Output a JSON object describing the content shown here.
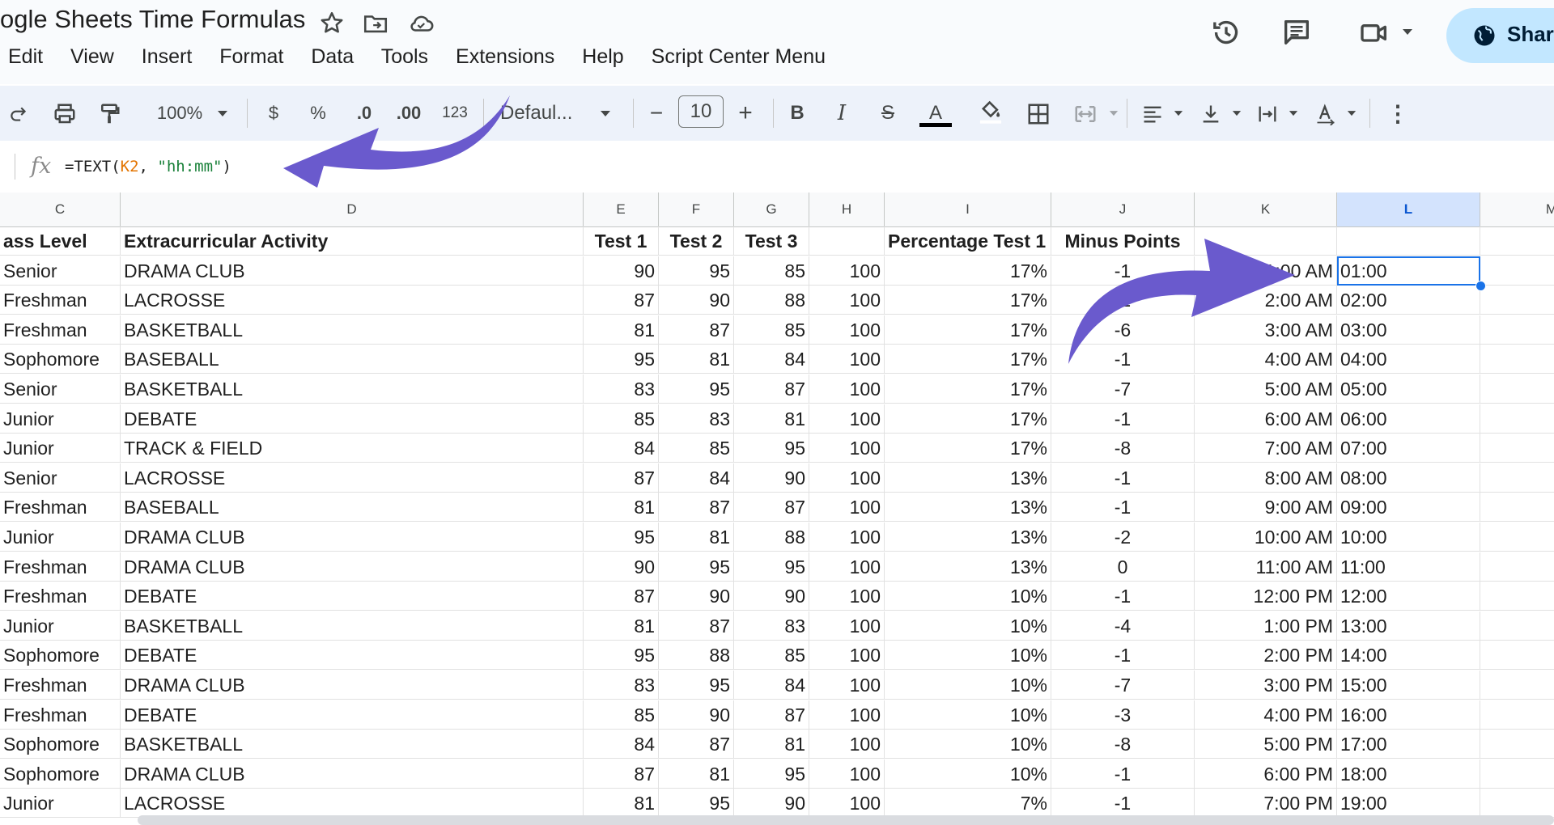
{
  "header": {
    "title": "ogle Sheets Time Formulas",
    "menu": [
      "Edit",
      "View",
      "Insert",
      "Format",
      "Data",
      "Tools",
      "Extensions",
      "Help",
      "Script Center Menu"
    ],
    "share_label": "Share"
  },
  "toolbar": {
    "zoom": "100%",
    "currency": "$",
    "percent": "%",
    "decrease_decimal": ".0",
    "increase_decimal": ".00",
    "number_format": "123",
    "font": "Defaul...",
    "font_size": "10",
    "minus": "−",
    "plus": "+",
    "bold": "B",
    "italic": "I",
    "strike": "S",
    "text_color": "A",
    "more": "⋮"
  },
  "formula_bar": {
    "fx": "fx",
    "formula_start": "=TEXT(",
    "formula_ref": "K2",
    "formula_sep": ", ",
    "formula_str": "\"hh:mm\"",
    "formula_end": ")"
  },
  "columns": [
    "C",
    "D",
    "E",
    "F",
    "G",
    "H",
    "I",
    "J",
    "K",
    "L",
    "M"
  ],
  "header_row": [
    "ass Level",
    "Extracurricular Activity",
    "Test 1",
    "Test 2",
    "Test 3",
    "",
    "Percentage Test 1",
    "Minus Points",
    "",
    "",
    ""
  ],
  "rows": [
    [
      "Senior",
      "DRAMA CLUB",
      "90",
      "95",
      "85",
      "100",
      "17%",
      "-1",
      "1:00 AM",
      "01:00"
    ],
    [
      "Freshman",
      "LACROSSE",
      "87",
      "90",
      "88",
      "100",
      "17%",
      "-1",
      "2:00 AM",
      "02:00"
    ],
    [
      "Freshman",
      "BASKETBALL",
      "81",
      "87",
      "85",
      "100",
      "17%",
      "-6",
      "3:00 AM",
      "03:00"
    ],
    [
      "Sophomore",
      "BASEBALL",
      "95",
      "81",
      "84",
      "100",
      "17%",
      "-1",
      "4:00 AM",
      "04:00"
    ],
    [
      "Senior",
      "BASKETBALL",
      "83",
      "95",
      "87",
      "100",
      "17%",
      "-7",
      "5:00 AM",
      "05:00"
    ],
    [
      "Junior",
      "DEBATE",
      "85",
      "83",
      "81",
      "100",
      "17%",
      "-1",
      "6:00 AM",
      "06:00"
    ],
    [
      "Junior",
      "TRACK & FIELD",
      "84",
      "85",
      "95",
      "100",
      "17%",
      "-8",
      "7:00 AM",
      "07:00"
    ],
    [
      "Senior",
      "LACROSSE",
      "87",
      "84",
      "90",
      "100",
      "13%",
      "-1",
      "8:00 AM",
      "08:00"
    ],
    [
      "Freshman",
      "BASEBALL",
      "81",
      "87",
      "87",
      "100",
      "13%",
      "-1",
      "9:00 AM",
      "09:00"
    ],
    [
      "Junior",
      "DRAMA CLUB",
      "95",
      "81",
      "88",
      "100",
      "13%",
      "-2",
      "10:00 AM",
      "10:00"
    ],
    [
      "Freshman",
      "DRAMA CLUB",
      "90",
      "95",
      "95",
      "100",
      "13%",
      "0",
      "11:00 AM",
      "11:00"
    ],
    [
      "Freshman",
      "DEBATE",
      "87",
      "90",
      "90",
      "100",
      "10%",
      "-1",
      "12:00 PM",
      "12:00"
    ],
    [
      "Junior",
      "BASKETBALL",
      "81",
      "87",
      "83",
      "100",
      "10%",
      "-4",
      "1:00 PM",
      "13:00"
    ],
    [
      "Sophomore",
      "DEBATE",
      "95",
      "88",
      "85",
      "100",
      "10%",
      "-1",
      "2:00 PM",
      "14:00"
    ],
    [
      "Freshman",
      "DRAMA CLUB",
      "83",
      "95",
      "84",
      "100",
      "10%",
      "-7",
      "3:00 PM",
      "15:00"
    ],
    [
      "Freshman",
      "DEBATE",
      "85",
      "90",
      "87",
      "100",
      "10%",
      "-3",
      "4:00 PM",
      "16:00"
    ],
    [
      "Sophomore",
      "BASKETBALL",
      "84",
      "87",
      "81",
      "100",
      "10%",
      "-8",
      "5:00 PM",
      "17:00"
    ],
    [
      "Sophomore",
      "DRAMA CLUB",
      "87",
      "81",
      "95",
      "100",
      "10%",
      "-1",
      "6:00 PM",
      "18:00"
    ],
    [
      "Junior",
      "LACROSSE",
      "81",
      "95",
      "90",
      "100",
      "7%",
      "-1",
      "7:00 PM",
      "19:00"
    ]
  ],
  "selected_column": "L",
  "colors": {
    "accent": "#1a73e8",
    "arrow": "#6a5acd",
    "share_bg": "#c2e7ff",
    "toolbar_bg": "#edf2fa"
  }
}
